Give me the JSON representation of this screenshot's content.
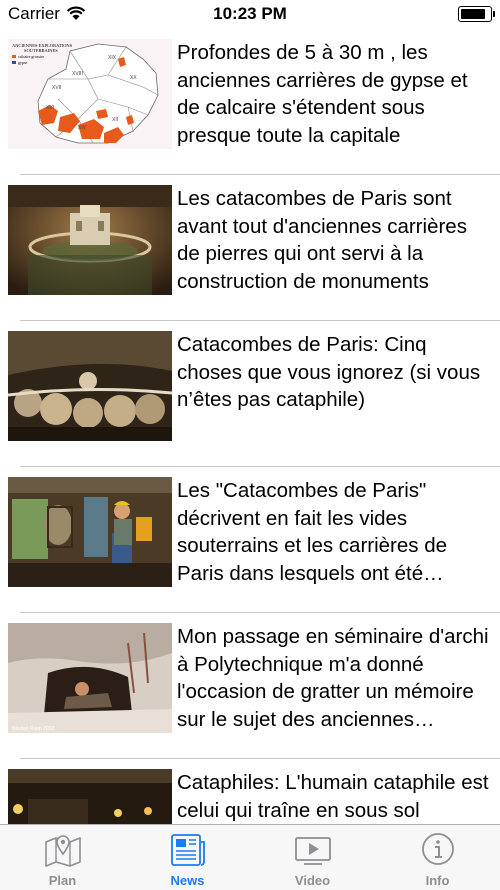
{
  "status_bar": {
    "carrier": "Carrier",
    "time": "10:23 PM",
    "battery_level": 0.9
  },
  "articles": [
    {
      "title": "Profondes de 5 à 30 m , les anciennes carrières de gypse et de calcaire s'étendent sous presque toute la capitale",
      "thumb_map_text": [
        "ANCIENNES EXPLORATIONS",
        "SOUTERRAINES",
        "calcaire grossier",
        "gypse"
      ],
      "thumb_colors": [
        "#f9f3f5",
        "#e85a1c"
      ]
    },
    {
      "title": "Les catacombes de Paris sont avant tout d'anciennes carrières de pierres qui ont servi à la construction de monuments",
      "thumb_colors": [
        "#3a2a1a",
        "#a07a48"
      ]
    },
    {
      "title": "Catacombes de Paris: Cinq choses que vous ignorez (si vous n’êtes pas cataphile)",
      "thumb_colors": [
        "#2e2418",
        "#c9b48e"
      ]
    },
    {
      "title": "Les \"Catacombes de Paris\" décrivent en fait les vides souterrains et les carrières de Paris dans lesquels ont été découverts",
      "thumb_colors": [
        "#4a3a26",
        "#e6a020"
      ]
    },
    {
      "title": "Mon passage en séminaire d'archi à Polytechnique m'a donné l'occasion de gratter un mémoire sur le sujet des anciennes carrières",
      "thumb_caption": "Nicolas Rapp 2012",
      "thumb_colors": [
        "#d8cfc4",
        "#6e5a48"
      ]
    },
    {
      "title": "Cataphiles: L'humain cataphile est celui qui traîne en sous sol",
      "thumb_colors": [
        "#241a10",
        "#f0d060"
      ]
    }
  ],
  "tabs": [
    {
      "label": "Plan",
      "icon": "map-icon",
      "active": false
    },
    {
      "label": "News",
      "icon": "news-icon",
      "active": true
    },
    {
      "label": "Video",
      "icon": "video-icon",
      "active": false
    },
    {
      "label": "Info",
      "icon": "info-icon",
      "active": false
    }
  ],
  "colors": {
    "accent": "#1a7cf5",
    "inactive": "#8e8e93",
    "separator": "#c8c7cc"
  }
}
